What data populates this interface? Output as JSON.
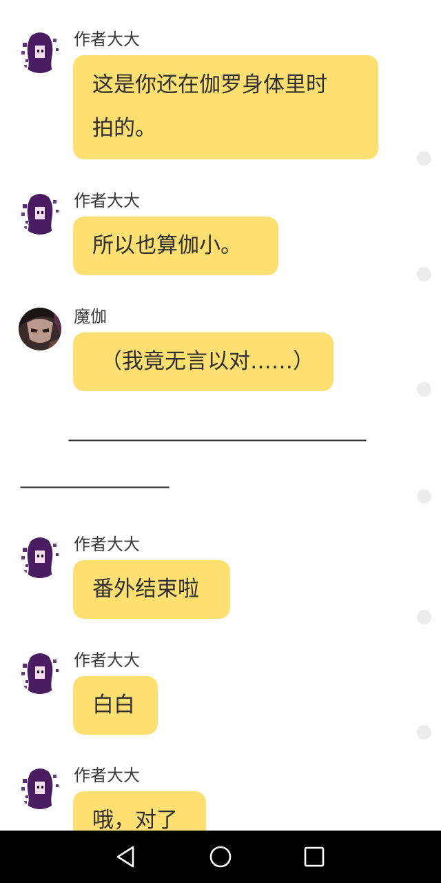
{
  "messages": [
    {
      "sender": "作者大大",
      "avatar": "author-avatar",
      "lines": [
        "这是你还在伽罗身体里时",
        "拍的。"
      ]
    },
    {
      "sender": "作者大大",
      "avatar": "author-avatar",
      "lines": [
        "所以也算伽小。"
      ]
    },
    {
      "sender": "魔伽",
      "avatar": "moga-avatar",
      "lines": [
        "（我竟无言以对……）"
      ]
    },
    {
      "sender": "作者大大",
      "avatar": "author-avatar",
      "lines": [
        "番外结束啦"
      ]
    },
    {
      "sender": "作者大大",
      "avatar": "author-avatar",
      "lines": [
        "白白"
      ]
    },
    {
      "sender": "作者大大",
      "avatar": "author-avatar",
      "lines": [
        "哦，对了"
      ]
    }
  ],
  "narration": {
    "line1": "————————————————",
    "line2": "————————"
  },
  "nav_bar": {
    "back": "back-triangle-icon",
    "home": "home-circle-icon",
    "recents": "recents-square-icon"
  },
  "colors": {
    "bubble": "#fddf72",
    "nav_background": "#000000",
    "dot": "#ececec"
  }
}
